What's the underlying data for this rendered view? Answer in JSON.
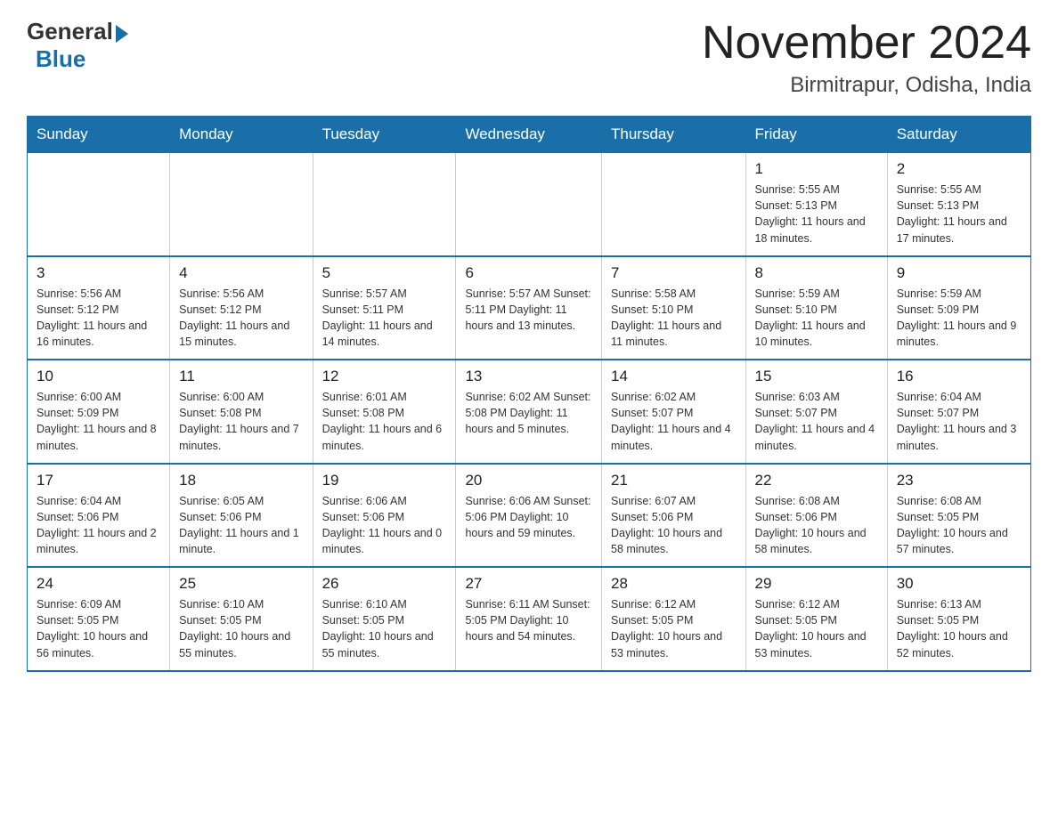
{
  "header": {
    "logo_general": "General",
    "logo_blue": "Blue",
    "month_title": "November 2024",
    "location": "Birmitrapur, Odisha, India"
  },
  "weekdays": [
    "Sunday",
    "Monday",
    "Tuesday",
    "Wednesday",
    "Thursday",
    "Friday",
    "Saturday"
  ],
  "weeks": [
    [
      {
        "day": "",
        "info": ""
      },
      {
        "day": "",
        "info": ""
      },
      {
        "day": "",
        "info": ""
      },
      {
        "day": "",
        "info": ""
      },
      {
        "day": "",
        "info": ""
      },
      {
        "day": "1",
        "info": "Sunrise: 5:55 AM\nSunset: 5:13 PM\nDaylight: 11 hours and 18 minutes."
      },
      {
        "day": "2",
        "info": "Sunrise: 5:55 AM\nSunset: 5:13 PM\nDaylight: 11 hours and 17 minutes."
      }
    ],
    [
      {
        "day": "3",
        "info": "Sunrise: 5:56 AM\nSunset: 5:12 PM\nDaylight: 11 hours and 16 minutes."
      },
      {
        "day": "4",
        "info": "Sunrise: 5:56 AM\nSunset: 5:12 PM\nDaylight: 11 hours and 15 minutes."
      },
      {
        "day": "5",
        "info": "Sunrise: 5:57 AM\nSunset: 5:11 PM\nDaylight: 11 hours and 14 minutes."
      },
      {
        "day": "6",
        "info": "Sunrise: 5:57 AM\nSunset: 5:11 PM\nDaylight: 11 hours and 13 minutes."
      },
      {
        "day": "7",
        "info": "Sunrise: 5:58 AM\nSunset: 5:10 PM\nDaylight: 11 hours and 11 minutes."
      },
      {
        "day": "8",
        "info": "Sunrise: 5:59 AM\nSunset: 5:10 PM\nDaylight: 11 hours and 10 minutes."
      },
      {
        "day": "9",
        "info": "Sunrise: 5:59 AM\nSunset: 5:09 PM\nDaylight: 11 hours and 9 minutes."
      }
    ],
    [
      {
        "day": "10",
        "info": "Sunrise: 6:00 AM\nSunset: 5:09 PM\nDaylight: 11 hours and 8 minutes."
      },
      {
        "day": "11",
        "info": "Sunrise: 6:00 AM\nSunset: 5:08 PM\nDaylight: 11 hours and 7 minutes."
      },
      {
        "day": "12",
        "info": "Sunrise: 6:01 AM\nSunset: 5:08 PM\nDaylight: 11 hours and 6 minutes."
      },
      {
        "day": "13",
        "info": "Sunrise: 6:02 AM\nSunset: 5:08 PM\nDaylight: 11 hours and 5 minutes."
      },
      {
        "day": "14",
        "info": "Sunrise: 6:02 AM\nSunset: 5:07 PM\nDaylight: 11 hours and 4 minutes."
      },
      {
        "day": "15",
        "info": "Sunrise: 6:03 AM\nSunset: 5:07 PM\nDaylight: 11 hours and 4 minutes."
      },
      {
        "day": "16",
        "info": "Sunrise: 6:04 AM\nSunset: 5:07 PM\nDaylight: 11 hours and 3 minutes."
      }
    ],
    [
      {
        "day": "17",
        "info": "Sunrise: 6:04 AM\nSunset: 5:06 PM\nDaylight: 11 hours and 2 minutes."
      },
      {
        "day": "18",
        "info": "Sunrise: 6:05 AM\nSunset: 5:06 PM\nDaylight: 11 hours and 1 minute."
      },
      {
        "day": "19",
        "info": "Sunrise: 6:06 AM\nSunset: 5:06 PM\nDaylight: 11 hours and 0 minutes."
      },
      {
        "day": "20",
        "info": "Sunrise: 6:06 AM\nSunset: 5:06 PM\nDaylight: 10 hours and 59 minutes."
      },
      {
        "day": "21",
        "info": "Sunrise: 6:07 AM\nSunset: 5:06 PM\nDaylight: 10 hours and 58 minutes."
      },
      {
        "day": "22",
        "info": "Sunrise: 6:08 AM\nSunset: 5:06 PM\nDaylight: 10 hours and 58 minutes."
      },
      {
        "day": "23",
        "info": "Sunrise: 6:08 AM\nSunset: 5:05 PM\nDaylight: 10 hours and 57 minutes."
      }
    ],
    [
      {
        "day": "24",
        "info": "Sunrise: 6:09 AM\nSunset: 5:05 PM\nDaylight: 10 hours and 56 minutes."
      },
      {
        "day": "25",
        "info": "Sunrise: 6:10 AM\nSunset: 5:05 PM\nDaylight: 10 hours and 55 minutes."
      },
      {
        "day": "26",
        "info": "Sunrise: 6:10 AM\nSunset: 5:05 PM\nDaylight: 10 hours and 55 minutes."
      },
      {
        "day": "27",
        "info": "Sunrise: 6:11 AM\nSunset: 5:05 PM\nDaylight: 10 hours and 54 minutes."
      },
      {
        "day": "28",
        "info": "Sunrise: 6:12 AM\nSunset: 5:05 PM\nDaylight: 10 hours and 53 minutes."
      },
      {
        "day": "29",
        "info": "Sunrise: 6:12 AM\nSunset: 5:05 PM\nDaylight: 10 hours and 53 minutes."
      },
      {
        "day": "30",
        "info": "Sunrise: 6:13 AM\nSunset: 5:05 PM\nDaylight: 10 hours and 52 minutes."
      }
    ]
  ]
}
